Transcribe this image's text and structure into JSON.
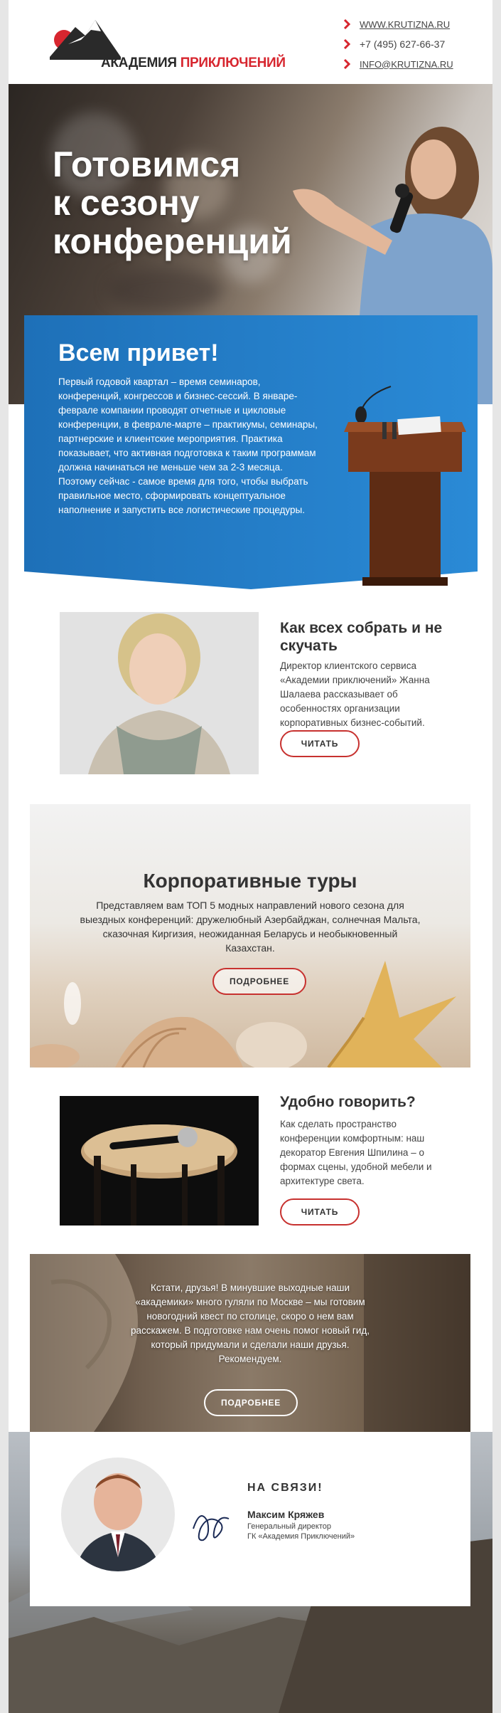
{
  "header": {
    "logo_word1": "АКАДЕМИЯ",
    "logo_word2": "ПРИКЛЮЧЕНИЙ",
    "contacts": [
      {
        "text": "WWW.KRUTIZNA.RU",
        "link": true
      },
      {
        "text": "+7 (495) 627-66-37",
        "link": false
      },
      {
        "text": "INFO@KRUTIZNA.RU",
        "link": true
      }
    ]
  },
  "hero": {
    "title_line1": "Готовимся",
    "title_line2": "к сезону",
    "title_line3": "конференций"
  },
  "intro": {
    "title": "Всем привет!",
    "text": "Первый годовой квартал – время семинаров, конференций, конгрессов и бизнес-сессий. В январе-феврале компании проводят отчетные и цикловые конференции, в феврале-марте – практикумы, семинары, партнерские и клиентские мероприятия. Практика показывает, что активная подготовка к таким программам должна начинаться не меньше чем за 2-3 месяца. Поэтому сейчас - самое время для того, чтобы выбрать правильное место, сформировать концептуальное наполнение и запустить все логистические процедуры."
  },
  "article1": {
    "title": "Как всех собрать и не скучать",
    "text": "Директор клиентского сервиса «Академии приключений» Жанна Шалаева рассказывает об особенностях организации корпоративных бизнес-событий.",
    "button": "ЧИТАТЬ"
  },
  "tours": {
    "title": "Корпоративные туры",
    "text": "Представляем вам ТОП 5 модных направлений нового сезона для выездных конференций: дружелюбный Азербайджан, солнечная Мальта, сказочная Киргизия, неожиданная Беларусь и необыкновенный Казахстан.",
    "button": "ПОДРОБНЕЕ"
  },
  "article2": {
    "title": "Удобно говорить?",
    "text": "Как сделать пространство конференции комфортным: наш декоратор Евгения Шпилина – о формах сцены, удобной мебели и архитектуре света.",
    "button": "ЧИТАТЬ"
  },
  "promo": {
    "text": "Кстати, друзья! В минувшие выходные наши «академики» много гуляли по Москве – мы готовим новогодний квест по столице, скоро о нем вам расскажем. В подготовке нам очень помог новый гид, который придумали и сделали наши друзья. Рекомендуем.",
    "button": "ПОДРОБНЕЕ"
  },
  "signature": {
    "heading": "НА СВЯЗИ!",
    "name": "Максим Кряжев",
    "role_line1": "Генеральный директор",
    "role_line2": "ГК «Академия Приключений»"
  },
  "colors": {
    "accent_red": "#d7262f",
    "button_border": "#c7312f",
    "intro_blue": "#1f7fc7"
  }
}
